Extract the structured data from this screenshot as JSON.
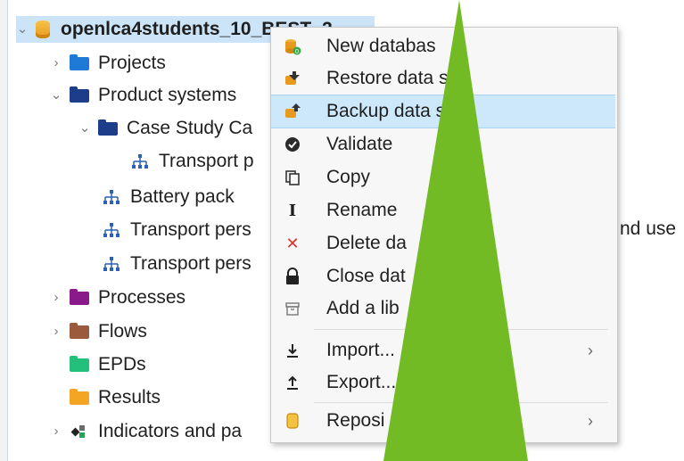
{
  "tree": {
    "root": {
      "label": "openlca4students_10_BEST_2"
    },
    "items": [
      {
        "label": "Projects",
        "color": "#1e7ad6"
      },
      {
        "label": "Product systems",
        "color": "#1b3d8a"
      },
      {
        "label": "Case Study Ca",
        "color": "#1b3d8a"
      },
      {
        "label": "Transport p"
      },
      {
        "label": "Battery pack"
      },
      {
        "label": "Transport pers"
      },
      {
        "label": "Transport pers"
      },
      {
        "label": "Processes",
        "color": "#8a1a8a"
      },
      {
        "label": "Flows",
        "color": "#9c5a3c"
      },
      {
        "label": "EPDs",
        "color": "#22c07a"
      },
      {
        "label": "Results",
        "color": "#f5a524"
      },
      {
        "label": "Indicators and pa"
      }
    ],
    "clipped_right_text": "nd use"
  },
  "context_menu": {
    "items": [
      {
        "label": "New databas",
        "icon": "new-database-icon"
      },
      {
        "label": "Restore data    se",
        "icon": "restore-database-icon"
      },
      {
        "label": "Backup data    se",
        "icon": "backup-database-icon",
        "highlighted": true
      },
      {
        "label": "Validate",
        "icon": "validate-icon"
      },
      {
        "label": "Copy",
        "icon": "copy-icon"
      },
      {
        "label": "Rename",
        "icon": "rename-icon"
      },
      {
        "label": "Delete da",
        "icon": "delete-icon"
      },
      {
        "label": "Close dat",
        "icon": "lock-icon"
      },
      {
        "label": "Add a lib",
        "icon": "library-icon"
      },
      {
        "label": "Import...",
        "icon": "import-icon",
        "submenu": true
      },
      {
        "label": "Export...",
        "icon": "export-icon"
      },
      {
        "label": "Reposi",
        "icon": "repository-icon",
        "submenu": true
      }
    ],
    "submenu_glyph": "›"
  },
  "colors": {
    "arrow": "#73bb25",
    "selection": "#cce4f7",
    "highlight": "#cde8fb"
  }
}
